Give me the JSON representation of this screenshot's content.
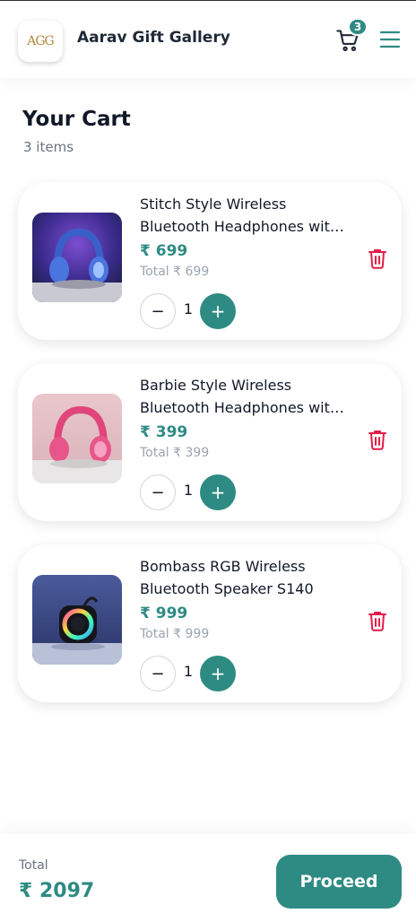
{
  "header": {
    "brand_name": "Aarav Gift Gallery",
    "logo_text": "AGG",
    "cart_count": "3"
  },
  "cart": {
    "title": "Your Cart",
    "item_count": "3 items",
    "items": [
      {
        "name": "Stitch Style Wireless Bluetooth Headphones with Mic",
        "price": "₹ 699",
        "subtotal": "Total ₹ 699",
        "quantity": "1",
        "image": "stitch-headphones"
      },
      {
        "name": "Barbie Style Wireless Bluetooth Headphones with Mic",
        "price": "₹ 399",
        "subtotal": "Total ₹ 399",
        "quantity": "1",
        "image": "barbie-headphones"
      },
      {
        "name": "Bombass RGB Wireless Bluetooth Speaker S140",
        "price": "₹ 999",
        "subtotal": "Total ₹ 999",
        "quantity": "1",
        "image": "rgb-speaker"
      }
    ],
    "minus_label": "−",
    "plus_label": "+"
  },
  "footer": {
    "total_label": "Total",
    "total_value": "₹ 2097",
    "proceed_label": "Proceed"
  },
  "colors": {
    "accent": "#2e8b83",
    "danger": "#e11d48",
    "muted": "#6b7280"
  }
}
